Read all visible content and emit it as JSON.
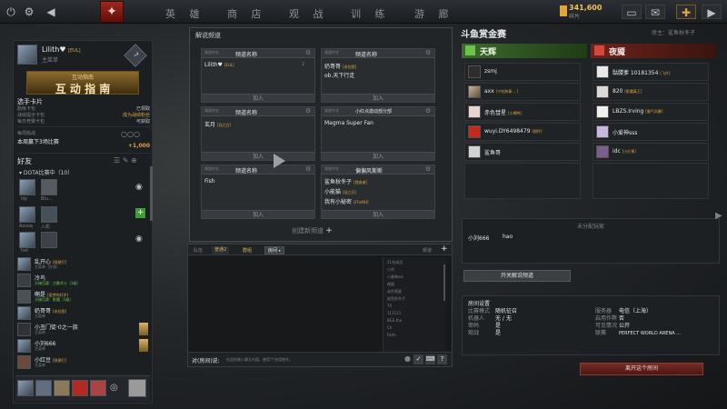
{
  "topbar": {
    "nav": [
      "英 雄",
      "商 店",
      "观 战",
      "训 练",
      "游 廊"
    ],
    "coins": "341,600",
    "coins_sub": "碎片"
  },
  "left": {
    "player_name": "Lilith♥",
    "player_tag": "[EUL]",
    "player_sub": "主菜单",
    "guide_top": "互动指南",
    "guide_banner": "互 动 指 南",
    "cards_title": "选手卡片",
    "cards_rows": [
      {
        "k": "勤练卡包",
        "v": "已领取"
      },
      {
        "k": "战绩提示卡包",
        "v": "成为战绩粉丝"
      },
      {
        "k": "每日竞赛卡包",
        "v": "可获取"
      }
    ],
    "weekly_title": "每周挑战",
    "weekly_desc": "本周赢下3场比赛",
    "weekly_reward": "+1,000",
    "friends_title": "好友",
    "group_title": "DOTA比赛中（10）",
    "tiles": [
      {
        "name": "lily"
      },
      {
        "name": "Blu..."
      },
      {
        "name": "Azusa"
      },
      {
        "name": "入机"
      },
      {
        "name": "hot"
      }
    ],
    "friends": [
      {
        "name": "乱开心",
        "tag": "[随便打]",
        "status": "主菜单（在线）"
      },
      {
        "name": "冷鸟",
        "tag": "",
        "status": "天梯比赛：古鹏术士（1级）"
      },
      {
        "name": "啊是",
        "tag": "[爱梦的好学]",
        "status": "天梯比赛：影魔（1级）"
      },
      {
        "name": "奶哥哥",
        "tag": "[米拉图]",
        "status": "主菜单"
      },
      {
        "name": "小丑门徒·0之一族",
        "tag": "",
        "status": "主菜单"
      },
      {
        "name": "小刘666",
        "tag": "",
        "status": "主菜单"
      },
      {
        "name": "小红豆",
        "tag": "[随便打]",
        "status": "主菜单"
      }
    ]
  },
  "lobby": {
    "title": "解说频道",
    "channels": [
      {
        "head": "频道名称",
        "members": [
          {
            "name": "Lilith♥",
            "tag": "[EUL]",
            "num": "2"
          }
        ],
        "join": "加入"
      },
      {
        "head": "频道名称",
        "members": [
          {
            "name": "奶哥哥",
            "tag": "[米拉图]",
            "num": ""
          },
          {
            "name": "ob.天下行走",
            "tag": "",
            "num": ""
          }
        ],
        "join": "加入"
      },
      {
        "head": "频道名称",
        "members": [
          {
            "name": "玄月",
            "tag": "[冠之召]",
            "num": ""
          }
        ],
        "join": "加入"
      },
      {
        "head": "小红点激动部分部",
        "members": [
          {
            "name": "Magma Super Fan",
            "tag": "",
            "num": ""
          }
        ],
        "join": "加入"
      },
      {
        "head": "频道名称",
        "members": [
          {
            "name": "Fish",
            "tag": "",
            "num": ""
          }
        ],
        "join": "加入"
      },
      {
        "head": "偏偏风斯断",
        "members": [
          {
            "name": "鲨鱼秋冬子",
            "tag": "[首座者]",
            "num": ""
          },
          {
            "name": "小能猫",
            "tag": "[冠之召]",
            "num": ""
          },
          {
            "name": "我有小秘密",
            "tag": "[FFoMH]",
            "num": ""
          }
        ],
        "join": "加入"
      }
    ],
    "create": "创建新频道"
  },
  "chat": {
    "tabs": [
      "队伍",
      "普通2",
      "群组",
      "房间"
    ],
    "right_label": "频道",
    "users": [
      "21名成员",
      "小刘",
      "小菱神sss",
      "夜魇",
      "赤色彗星",
      "鲨鱼秋冬子",
      "70",
      "111111",
      "BGS.the",
      "Ch",
      "Faith"
    ],
    "input_label": "对(房间)说:",
    "input_placeholder": "在此处输入聊天内容。使用\"/\"启用指令。"
  },
  "match": {
    "title": "斗鱼赏金赛",
    "host_label": "房主：鲨鱼秋冬子",
    "radiant": "天辉",
    "dire": "夜魇",
    "radiant_players": [
      {
        "name": "zsmj",
        "tag": ""
      },
      {
        "name": "axx",
        "tag": "[宁吃肿鼻·...]"
      },
      {
        "name": "赤色彗星",
        "tag": "[小棉鸭]"
      },
      {
        "name": "wuyi.DY6498479",
        "tag": "[燃怀]"
      },
      {
        "name": "鲨鱼哥",
        "tag": ""
      }
    ],
    "dire_players": [
      {
        "name": "骷髅爹 10181354",
        "tag": "[飞升]"
      },
      {
        "name": "820",
        "tag": "[影魔真王]"
      },
      {
        "name": "LBZS.Irving",
        "tag": "[霸气风暴]"
      },
      {
        "name": "小爱神sss",
        "tag": ""
      },
      {
        "name": "idc",
        "tag": "[小红果]"
      }
    ],
    "unassigned_title": "未分配玩家",
    "unassigned_player": "小刘666",
    "unassigned_extra": "hao",
    "open_commentary": "开关解说频道",
    "settings_title": "房间设置",
    "settings_left": [
      {
        "k": "比赛模式",
        "v": "随机征召"
      },
      {
        "k": "机器人",
        "v": "无 / 无"
      },
      {
        "k": "密码",
        "v": "是"
      },
      {
        "k": "观战",
        "v": "是"
      }
    ],
    "settings_right": [
      {
        "k": "服务器",
        "v": "电信（上海）"
      },
      {
        "k": "启用作弊",
        "v": "否"
      },
      {
        "k": "可见情况",
        "v": "公开"
      },
      {
        "k": "联赛",
        "v": "PERFECT WORLD ARENA ..."
      }
    ],
    "leave": "离开这个房间"
  },
  "colors": {
    "accent_red": "#b1231b",
    "radiant": "#6cc24a",
    "dire": "#d2483c",
    "gold": "#f1c357"
  }
}
